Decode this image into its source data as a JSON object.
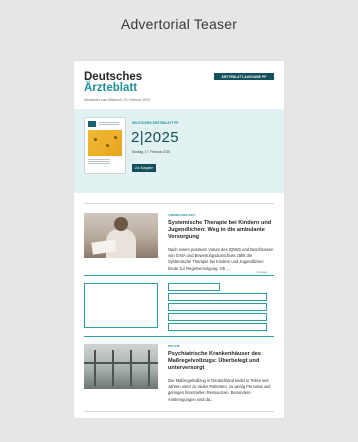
{
  "page": {
    "title": "Advertorial Teaser"
  },
  "header": {
    "brand_line1": "Deutsches",
    "brand_line2": "Ärzteblatt",
    "cta_label": "ÄRZTEBLATT-AUSGABE PP",
    "newsletter_date": "Newsletter vom Mittwoch, 19. Februar 2025"
  },
  "issue": {
    "label": "DEUTSCHES ÄRZTEBLATT PP",
    "number": "2|2025",
    "date": "Montag, 17. Februar 2025",
    "button_label": "Zur Ausgabe"
  },
  "articles": [
    {
      "kicker": "THEMEN DER ZEIT",
      "title": "Systemische Therapie bei Kindern und Jugendlichen: Weg in die ambulante Versorgung",
      "excerpt": "Nach einem positiven Votum des IQWiG und Beschlüssen von G-BA und Bewertungsausschuss zählt die Systemische Therapie bei Kindern und Jugendlichen heute zur Regelversorgung. Ob ..."
    },
    {
      "kicker": "POLITIK",
      "title": "Psychiatrische Krankenhäuser des Maßregelvollzugs: Überbelegt und unterversorgt",
      "excerpt": "Der Maßregelvollzug in Deutschland leidet in Teilen seit Jahren unter zu vielen Patienten, zu wenig Personal und geringen finanziellen Ressourcen. Besondere Anstrengungen sind da..."
    }
  ],
  "advertorial": {
    "label": "Anzeige"
  },
  "colors": {
    "accent": "#1f8f9a",
    "dark": "#13515a",
    "issue_bg": "#e2f2f3",
    "page_bg": "#e6e6e6"
  }
}
